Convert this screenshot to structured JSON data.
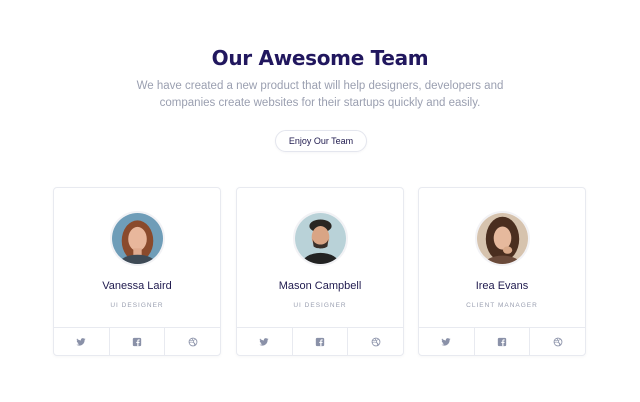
{
  "header": {
    "title": "Our Awesome Team",
    "subtitle": "We have created a new product that will help designers, developers and companies create websites for their startups quickly and easily.",
    "cta_label": "Enjoy Our Team"
  },
  "team": [
    {
      "name": "Vanessa Laird",
      "role": "UI DESIGNER"
    },
    {
      "name": "Mason Campbell",
      "role": "UI DESIGNER"
    },
    {
      "name": "Irea Evans",
      "role": "CLIENT MANAGER"
    }
  ],
  "social_icons": [
    "twitter-icon",
    "facebook-icon",
    "dribbble-icon"
  ],
  "colors": {
    "title": "#21175e",
    "text_muted": "#9a9fb0",
    "border": "#e8eaf0",
    "icon": "#8a91a8"
  }
}
